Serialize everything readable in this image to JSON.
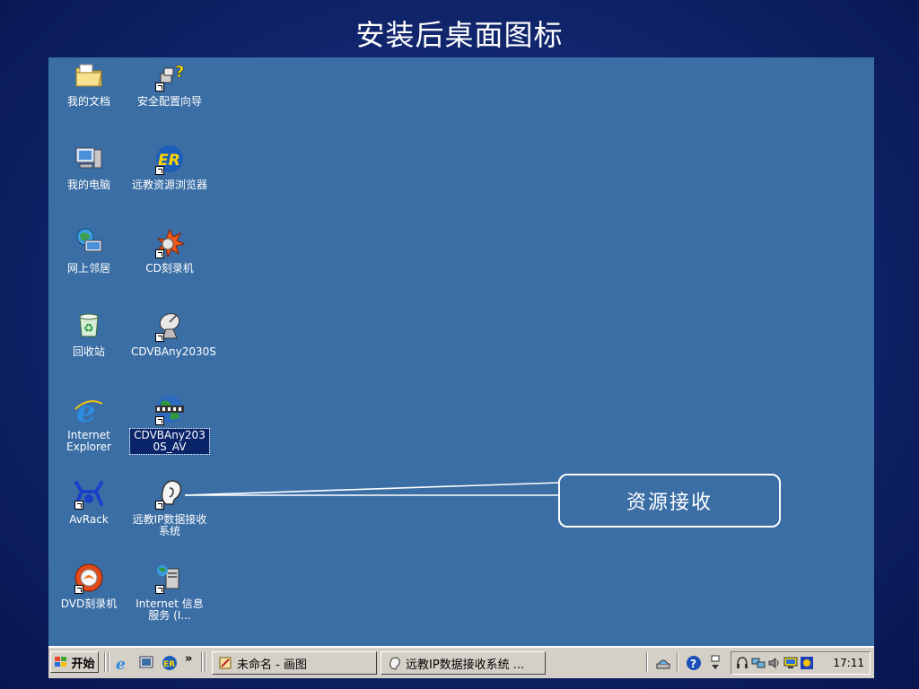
{
  "slide": {
    "title": "安装后桌面图标"
  },
  "desktop": {
    "icons": [
      {
        "label": "我的文档",
        "icon": "folder-icon"
      },
      {
        "label": "安全配置向导",
        "icon": "wizard-icon"
      },
      {
        "label": "我的电脑",
        "icon": "computer-icon"
      },
      {
        "label": "远教资源浏览器",
        "icon": "er-browser-icon"
      },
      {
        "label": "网上邻居",
        "icon": "network-icon"
      },
      {
        "label": "CD刻录机",
        "icon": "cd-burner-icon"
      },
      {
        "label": "回收站",
        "icon": "recycle-bin-icon"
      },
      {
        "label": "CDVBAny2030S",
        "icon": "satellite-dish-icon"
      },
      {
        "label": "Internet Explorer",
        "icon": "ie-icon"
      },
      {
        "label": "CDVBAny2030S_AV",
        "icon": "globe-film-icon"
      },
      {
        "label": "AvRack",
        "icon": "avrack-icon"
      },
      {
        "label": "远教IP数据接收系统",
        "icon": "ear-icon"
      },
      {
        "label": "DVD刻录机",
        "icon": "dvd-burner-icon"
      },
      {
        "label": "Internet 信息服务 (I...",
        "icon": "iis-icon"
      }
    ]
  },
  "callout": {
    "text": "资源接收"
  },
  "taskbar": {
    "start_label": "开始",
    "chevron": "»",
    "tasks": [
      {
        "label": "未命名 - 画图",
        "icon": "paint-icon"
      },
      {
        "label": "远教IP数据接收系统 ...",
        "icon": "ear-icon"
      }
    ],
    "clock": "17:11"
  },
  "colors": {
    "desktop": "#3a6ea5",
    "taskbar": "#d4d0c8",
    "selection": "#0a246a"
  }
}
